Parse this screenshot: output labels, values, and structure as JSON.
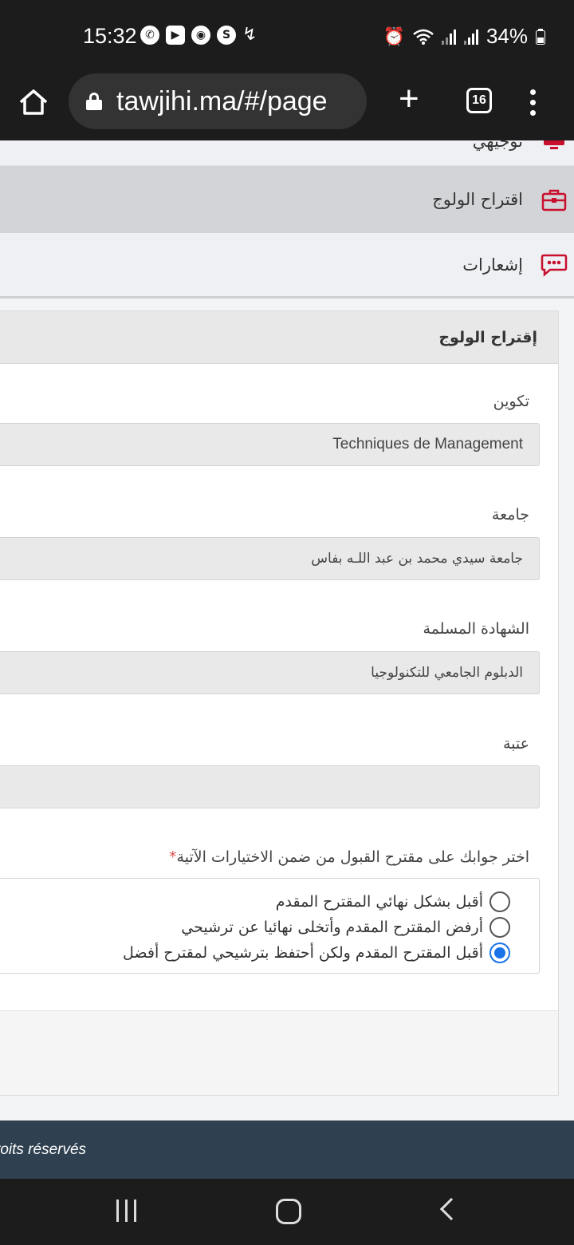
{
  "status_bar": {
    "time": "15:32",
    "battery": "34%",
    "icons": [
      "whatsapp-icon",
      "youtube-icon",
      "chrome-icon",
      "skype-icon",
      "missed-call-icon",
      "alarm-icon",
      "wifi-icon",
      "signal-icon",
      "battery-icon"
    ]
  },
  "browser": {
    "url": "tawjihi.ma/#/page",
    "tab_count": "16",
    "new_tab_label": "+"
  },
  "sidebar": {
    "partial_item": "توجيهي",
    "items": [
      {
        "label": "اقتراح الولوج",
        "icon": "briefcase-icon"
      },
      {
        "label": "إشعارات",
        "icon": "chat-bubble-icon"
      }
    ]
  },
  "card": {
    "title": "إقتراح الولوج",
    "fields": [
      {
        "label": "تكوين",
        "value": "Techniques de Management"
      },
      {
        "label": "جامعة",
        "value": "جامعة سيدي محمد بن عبد اللـه بفاس"
      },
      {
        "label": "الشهادة المسلمة",
        "value": "الدبلوم الجامعي للتكنولوجيا"
      },
      {
        "label": "عتبة",
        "value": ""
      }
    ],
    "question": "اختر جوابك على مقترح القبول من ضمن الاختيارات الآتية",
    "required_mark": "*",
    "options": [
      {
        "label": "أقبل بشكل نهائي المقترح المقدم",
        "checked": false
      },
      {
        "label": "أرفض المقترح المقدم وأتخلى نهائيا عن ترشيحي",
        "checked": false
      },
      {
        "label": "أقبل المقترح المقدم ولكن أحتفظ بترشيحي لمقترح أفضل",
        "checked": true
      }
    ]
  },
  "footer": {
    "text": "roits réservés"
  },
  "colors": {
    "accent": "#1a73e8",
    "icon_red": "#c8102e",
    "footer_bg": "#2f4050",
    "required": "#d9534f"
  }
}
